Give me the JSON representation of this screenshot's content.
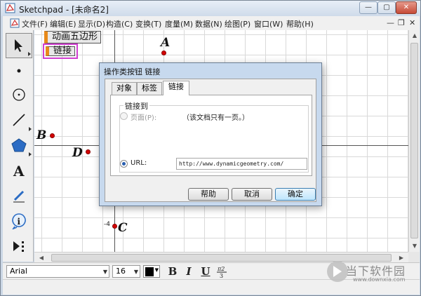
{
  "window": {
    "title": "Sketchpad - [未命名2]",
    "controls": {
      "minimize": "—",
      "maximize": "▢",
      "close": "✕"
    }
  },
  "menubar": {
    "items": [
      "文件(F)",
      "编辑(E)",
      "显示(D)",
      "构造(C)",
      "变换(T)",
      "度量(M)",
      "数据(N)",
      "绘图(P)",
      "窗口(W)",
      "帮助(H)"
    ],
    "mdi_controls": {
      "minimize": "—",
      "restore": "❐",
      "close": "✕"
    }
  },
  "toolbox": {
    "tools": [
      "arrow-select-icon",
      "point-icon",
      "compass-icon",
      "straightedge-icon",
      "polygon-icon",
      "text-icon",
      "marker-icon",
      "information-icon",
      "custom-tool-icon"
    ]
  },
  "canvas": {
    "buttons": {
      "animate": "动画五边形",
      "link": "链接"
    },
    "points": {
      "A": "A",
      "B": "B",
      "C": "C",
      "D": "D"
    },
    "tick_label": "-4"
  },
  "format_bar": {
    "font": "Arial",
    "size": "16",
    "text_color": "#000000",
    "bold": "B",
    "italic": "I",
    "underline": "U"
  },
  "dialog": {
    "title": "操作类按钮 链接",
    "tabs": [
      "对象",
      "标签",
      "链接"
    ],
    "active_tab": "链接",
    "group_title": "链接到",
    "page_option": {
      "label": "页面(P):",
      "note": "（该文档只有一页。）",
      "enabled": false
    },
    "url_option": {
      "label": "URL:",
      "selected": true
    },
    "url_value": "http://www.dynamicgeometry.com/",
    "buttons": {
      "help": "帮助",
      "cancel": "取消",
      "ok": "确定"
    }
  },
  "watermark": {
    "text": "当下软件园",
    "url": "www.downxia.com"
  }
}
